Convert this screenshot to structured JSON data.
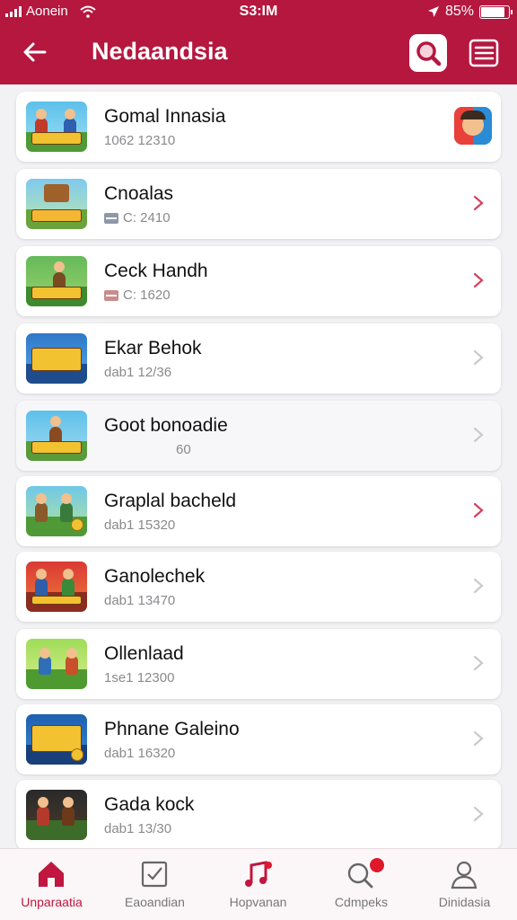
{
  "status_bar": {
    "carrier": "Aonein",
    "time": "S3:IM",
    "battery": "85%",
    "battery_level": 0.85
  },
  "header": {
    "title": "Nedaandsia",
    "back_icon": "arrow-left-icon",
    "search_icon": "search-icon",
    "menu_icon": "list-menu-icon"
  },
  "colors": {
    "brand": "#b5173f",
    "accent": "#c0163f",
    "chevron_active": "#d2435f",
    "chevron_muted": "#c9c9cf"
  },
  "items": [
    {
      "title": "Gomal Innasia",
      "meta": "1062 12310",
      "meta_icon": false,
      "trailing": "app-avatar"
    },
    {
      "title": "Cnoalas",
      "meta": "C: 2410",
      "meta_icon": true,
      "trailing": "chevron-active"
    },
    {
      "title": "Ceck Handh",
      "meta": "C: 1620",
      "meta_icon": true,
      "trailing": "chevron-active"
    },
    {
      "title": "Ekar Behok",
      "meta": "dab1 12/36",
      "meta_icon": false,
      "trailing": "chevron-muted"
    },
    {
      "title": "Goot bonoadie",
      "meta": "60",
      "meta_icon": false,
      "trailing": "chevron-muted"
    },
    {
      "title": "Graplal bacheld",
      "meta": "dab1 15320",
      "meta_icon": false,
      "trailing": "chevron-active"
    },
    {
      "title": "Ganolechek",
      "meta": "dab1 13470",
      "meta_icon": false,
      "trailing": "chevron-muted"
    },
    {
      "title": "Ollenlaad",
      "meta": "1se1 12300",
      "meta_icon": false,
      "trailing": "chevron-muted"
    },
    {
      "title": "Phnane Galeino",
      "meta": "dab1 16320",
      "meta_icon": false,
      "trailing": "chevron-muted"
    },
    {
      "title": "Gada kock",
      "meta": "dab1 13/30",
      "meta_icon": false,
      "trailing": "chevron-muted"
    }
  ],
  "tabs": [
    {
      "label": "Unparaatia",
      "icon": "home-icon",
      "active": true
    },
    {
      "label": "Eaoandian",
      "icon": "edit-box-icon",
      "active": false
    },
    {
      "label": "Hopvanan",
      "icon": "music-note-icon",
      "active": false
    },
    {
      "label": "Cdmpeks",
      "icon": "search-notify-icon",
      "active": false,
      "badge": true
    },
    {
      "label": "Dinidasia",
      "icon": "profile-icon",
      "active": false
    }
  ]
}
